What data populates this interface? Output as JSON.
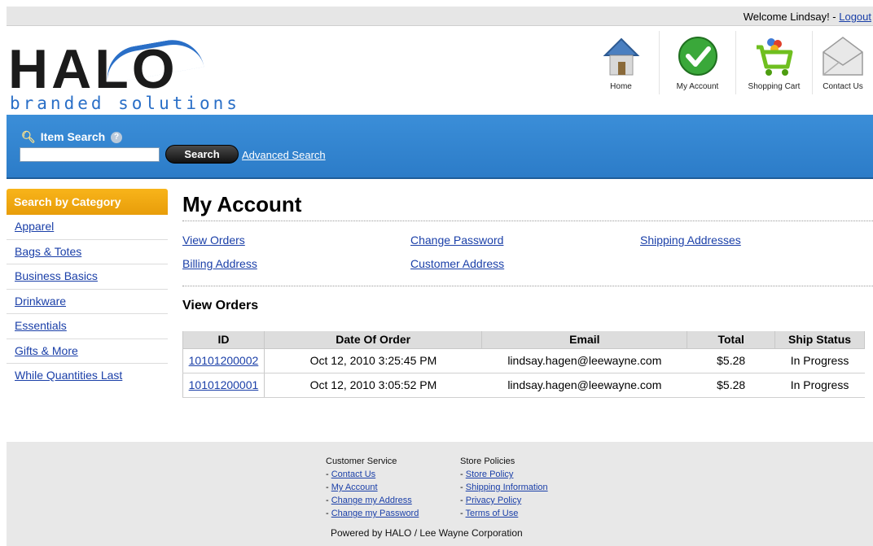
{
  "topbar": {
    "welcome": "Welcome Lindsay! - ",
    "logout": "Logout"
  },
  "logo": {
    "mark": "HALO",
    "sub": "branded solutions"
  },
  "nav": [
    {
      "label": "Home",
      "icon": "home-icon"
    },
    {
      "label": "My Account",
      "icon": "checkmark-icon"
    },
    {
      "label": "Shopping Cart",
      "icon": "shopping-cart-icon"
    },
    {
      "label": "Contact Us",
      "icon": "envelope-icon"
    }
  ],
  "search": {
    "title": "Item Search",
    "help": "?",
    "value": "",
    "button": "Search",
    "advanced": "Advanced Search"
  },
  "sidebar": {
    "heading": "Search by Category",
    "items": [
      "Apparel",
      "Bags & Totes",
      "Business Basics",
      "Drinkware",
      "Essentials",
      "Gifts & More",
      "While Quantities Last"
    ]
  },
  "main": {
    "title": "My Account",
    "links": {
      "view_orders": "View Orders",
      "change_password": "Change Password",
      "shipping_addresses": "Shipping Addresses",
      "billing_address": "Billing Address",
      "customer_address": "Customer Address"
    },
    "section_title": "View Orders",
    "table": {
      "headers": [
        "ID",
        "Date Of Order",
        "Email",
        "Total",
        "Ship Status"
      ],
      "rows": [
        {
          "id": "10101200002",
          "date": "Oct 12, 2010 3:25:45 PM",
          "email": "lindsay.hagen@leewayne.com",
          "total": "$5.28",
          "status": "In Progress"
        },
        {
          "id": "10101200001",
          "date": "Oct 12, 2010 3:05:52 PM",
          "email": "lindsay.hagen@leewayne.com",
          "total": "$5.28",
          "status": "In Progress"
        }
      ]
    }
  },
  "footer": {
    "col1": {
      "heading": "Customer Service",
      "links": [
        "Contact Us",
        "My Account",
        "Change my Address",
        "Change my Password"
      ]
    },
    "col2": {
      "heading": "Store Policies",
      "links": [
        "Store Policy",
        "Shipping Information",
        "Privacy Policy",
        "Terms of Use"
      ]
    },
    "powered": "Powered by HALO / Lee Wayne Corporation",
    "bullet": "- "
  },
  "colors": {
    "search_band": "#2c7cc8",
    "category_head": "#f0a614",
    "link": "#1a3fa8"
  }
}
